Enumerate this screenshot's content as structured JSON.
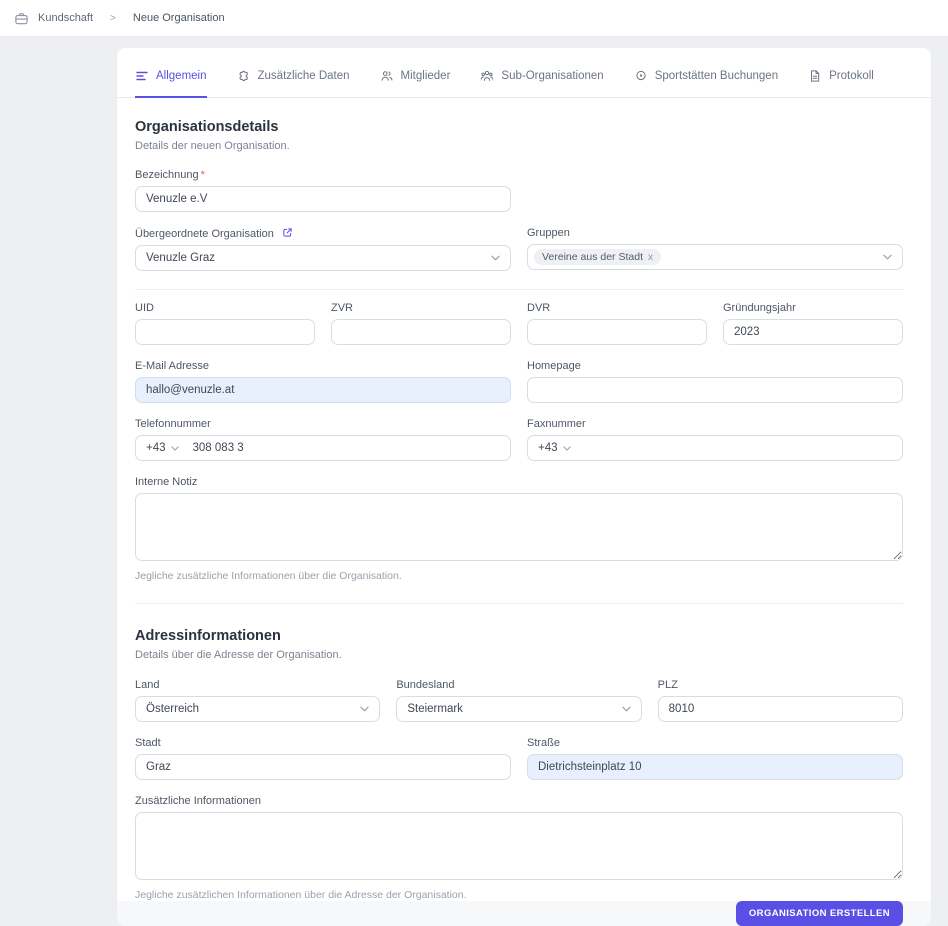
{
  "breadcrumb": {
    "icon": "briefcase-icon",
    "root": "Kundschaft",
    "separator": ">",
    "current": "Neue Organisation"
  },
  "tabs": [
    {
      "label": "Allgemein",
      "icon": "list-lines-icon",
      "active": true
    },
    {
      "label": "Zusätzliche Daten",
      "icon": "puzzle-icon",
      "active": false
    },
    {
      "label": "Mitglieder",
      "icon": "users-icon",
      "active": false
    },
    {
      "label": "Sub-Organisationen",
      "icon": "users-group-icon",
      "active": false
    },
    {
      "label": "Sportstätten Buchungen",
      "icon": "location-icon",
      "active": false
    },
    {
      "label": "Protokoll",
      "icon": "document-icon",
      "active": false
    }
  ],
  "org_section": {
    "title": "Organisationsdetails",
    "subtitle": "Details der neuen Organisation.",
    "bezeichnung": {
      "label": "Bezeichnung",
      "required_mark": "*",
      "value": "Venuzle e.V"
    },
    "parent_org": {
      "label": "Übergeordnete Organisation",
      "icon": "external-link-icon",
      "value": "Venuzle Graz"
    },
    "gruppen": {
      "label": "Gruppen",
      "chip_label": "Vereine aus der Stadt",
      "chip_remove": "x"
    },
    "uid": {
      "label": "UID",
      "value": ""
    },
    "zvr": {
      "label": "ZVR",
      "value": ""
    },
    "dvr": {
      "label": "DVR",
      "value": ""
    },
    "gruendungsjahr": {
      "label": "Gründungsjahr",
      "value": "2023"
    },
    "email": {
      "label": "E-Mail Adresse",
      "value": "hallo@venuzle.at"
    },
    "homepage": {
      "label": "Homepage",
      "value": ""
    },
    "telefon": {
      "label": "Telefonnummer",
      "country_code": "+43",
      "value": "308 083 3"
    },
    "fax": {
      "label": "Faxnummer",
      "country_code": "+43",
      "value": ""
    },
    "interne_notiz": {
      "label": "Interne Notiz",
      "value": "",
      "helper": "Jegliche zusätzliche Informationen über die Organisation."
    }
  },
  "address_section": {
    "title": "Adressinformationen",
    "subtitle": "Details über die Adresse der Organisation.",
    "land": {
      "label": "Land",
      "value": "Österreich"
    },
    "bundesland": {
      "label": "Bundesland",
      "value": "Steiermark"
    },
    "plz": {
      "label": "PLZ",
      "value": "8010"
    },
    "stadt": {
      "label": "Stadt",
      "value": "Graz"
    },
    "strasse": {
      "label": "Straße",
      "value": "Dietrichsteinplatz 10"
    },
    "zusatz_info": {
      "label": "Zusätzliche Informationen",
      "value": "",
      "helper": "Jegliche zusätzlichen Informationen über die Adresse der Organisation."
    }
  },
  "footer": {
    "submit_label": "ORGANISATION ERSTELLEN"
  },
  "colors": {
    "accent": "#5a4fe4",
    "autofill_bg": "#e8f0fe",
    "required": "#e8604c",
    "page_bg": "#edeff2"
  }
}
